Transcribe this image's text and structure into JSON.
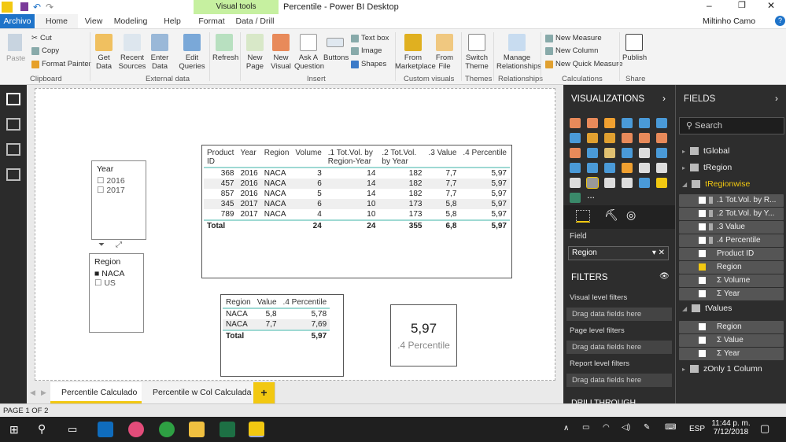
{
  "window": {
    "title": "Percentile - Power BI Desktop",
    "contextual_group": "Visual tools",
    "user": "Miltinho Camo"
  },
  "tabs": [
    {
      "label": "Archivo"
    },
    {
      "label": "Home"
    },
    {
      "label": "View"
    },
    {
      "label": "Modeling"
    },
    {
      "label": "Help"
    },
    {
      "label": "Format"
    },
    {
      "label": "Data / Drill"
    }
  ],
  "ribbon": {
    "clipboard": {
      "paste": "Paste",
      "cut": "Cut",
      "copy": "Copy",
      "format_painter": "Format Painter",
      "group": "Clipboard"
    },
    "external": {
      "get_data": "Get Data",
      "recent": "Recent Sources",
      "enter": "Enter Data",
      "edit": "Edit Queries",
      "group": "External data"
    },
    "refresh": "Refresh",
    "insert": {
      "new_page": "New Page",
      "new_visual": "New Visual",
      "ask": "Ask A Question",
      "buttons": "Buttons",
      "text_box": "Text box",
      "image": "Image",
      "shapes": "Shapes",
      "group": "Insert"
    },
    "custom": {
      "marketplace": "From Marketplace",
      "file": "From File",
      "group": "Custom visuals"
    },
    "themes": {
      "switch": "Switch Theme",
      "group": "Themes"
    },
    "relationships": {
      "manage": "Manage Relationships",
      "group": "Relationships"
    },
    "calculations": {
      "new_measure": "New Measure",
      "new_column": "New Column",
      "new_quick": "New Quick Measure",
      "group": "Calculations"
    },
    "share": {
      "publish": "Publish",
      "group": "Share"
    }
  },
  "slicer_year": {
    "title": "Year",
    "items": [
      {
        "label": "2016",
        "checked": false
      },
      {
        "label": "2017",
        "checked": false
      }
    ]
  },
  "slicer_region": {
    "title": "Region",
    "items": [
      {
        "label": "NACA",
        "checked": true
      },
      {
        "label": "US",
        "checked": false
      }
    ]
  },
  "main_table": {
    "headers": [
      "Product ID",
      "Year",
      "Region",
      "Volume",
      ".1 Tot.Vol. by Region-Year",
      ".2 Tot.Vol. by Year",
      ".3 Value",
      ".4 Percentile"
    ],
    "rows": [
      [
        "368",
        "2016",
        "NACA",
        "3",
        "14",
        "182",
        "7,7",
        "5,97"
      ],
      [
        "457",
        "2016",
        "NACA",
        "6",
        "14",
        "182",
        "7,7",
        "5,97"
      ],
      [
        "857",
        "2016",
        "NACA",
        "5",
        "14",
        "182",
        "7,7",
        "5,97"
      ],
      [
        "345",
        "2017",
        "NACA",
        "6",
        "10",
        "173",
        "5,8",
        "5,97"
      ],
      [
        "789",
        "2017",
        "NACA",
        "4",
        "10",
        "173",
        "5,8",
        "5,97"
      ]
    ],
    "total": [
      "Total",
      "",
      "",
      "24",
      "24",
      "355",
      "6,8",
      "5,97"
    ]
  },
  "small_table": {
    "headers": [
      "Region",
      "Value",
      ".4 Percentile"
    ],
    "rows": [
      [
        "NACA",
        "5,8",
        "5,78"
      ],
      [
        "NACA",
        "7,7",
        "7,69"
      ]
    ],
    "total": [
      "Total",
      "",
      "5,97"
    ]
  },
  "card": {
    "value": "5,97",
    "label": ".4 Percentile"
  },
  "page_tabs": [
    {
      "label": "Percentile Calculado",
      "active": true
    },
    {
      "label": "Percentile w Col Calculada",
      "active": false
    }
  ],
  "add_page": "+",
  "visualizations": {
    "title": "VISUALIZATIONS",
    "field_label": "Field",
    "field_value": "Region",
    "filters_title": "FILTERS",
    "visual_filters": "Visual level filters",
    "page_filters": "Page level filters",
    "report_filters": "Report level filters",
    "drag": "Drag data fields here",
    "drillthrough": "DRILLTHROUGH",
    "more": "..."
  },
  "fields": {
    "title": "FIELDS",
    "search_placeholder": "Search",
    "tables": [
      {
        "name": "tGlobal"
      },
      {
        "name": "tRegion"
      },
      {
        "name": "tRegionwise",
        "expanded": true
      }
    ],
    "regionwise_fields": [
      {
        "name": ".1 Tot.Vol. by R...",
        "checked": false
      },
      {
        "name": ".2 Tot.Vol. by Y...",
        "checked": false
      },
      {
        "name": ".3 Value",
        "checked": false
      },
      {
        "name": ".4 Percentile",
        "checked": false
      },
      {
        "name": "Product ID",
        "checked": false
      },
      {
        "name": "Region",
        "checked": true
      },
      {
        "name": "Σ Volume",
        "checked": false
      },
      {
        "name": "Σ Year",
        "checked": false
      }
    ],
    "tvalues": {
      "name": "tValues",
      "fields": [
        {
          "name": "Region",
          "checked": false
        },
        {
          "name": "Σ Value",
          "checked": false
        },
        {
          "name": "Σ Year",
          "checked": false
        }
      ]
    },
    "zonly": "zOnly 1 Column"
  },
  "status": "PAGE 1 OF 2",
  "taskbar": {
    "lang": "ESP",
    "time": "11:44 p. m.",
    "date": "7/12/2018"
  },
  "colors": {
    "accent": "#f2c811",
    "file_tab": "#1e73c9",
    "visual_tools": "#c6f0a0",
    "table_line": "#9ed9d3"
  }
}
